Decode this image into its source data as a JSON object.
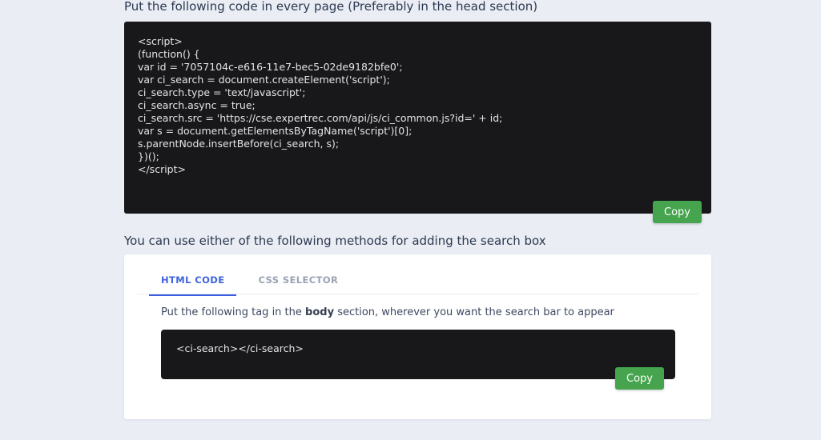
{
  "theme": {
    "page_background": "#eaedf4",
    "card_background": "#ffffff",
    "code_background": "#18181b",
    "accent_blue": "#3e63de",
    "accent_green": "#45a44d",
    "heading_color": "#2c3950"
  },
  "script_section": {
    "heading": "Put the following code in every page (Preferably in the head section)",
    "code_lines": [
      "<script>",
      "(function() {",
      "var id = '7057104c-e616-11e7-bec5-02de9182bfe0';",
      "var ci_search = document.createElement('script');",
      "ci_search.type = 'text/javascript';",
      "ci_search.async = true;",
      "ci_search.src = 'https://cse.expertrec.com/api/js/ci_common.js?id=' + id;",
      "var s = document.getElementsByTagName('script')[0];",
      "s.parentNode.insertBefore(ci_search, s);",
      "})();",
      "</script>"
    ],
    "copy_label": "Copy"
  },
  "searchbox_section": {
    "heading": "You can use either of the following methods for adding the search box",
    "tabs": [
      {
        "label": "HTML CODE",
        "active": true
      },
      {
        "label": "CSS SELECTOR",
        "active": false
      }
    ],
    "instruction_prefix": "Put the following tag in the ",
    "instruction_bold": "body",
    "instruction_suffix": " section, wherever you want the search bar to appear",
    "code": "<ci-search></ci-search>",
    "copy_label": "Copy"
  }
}
